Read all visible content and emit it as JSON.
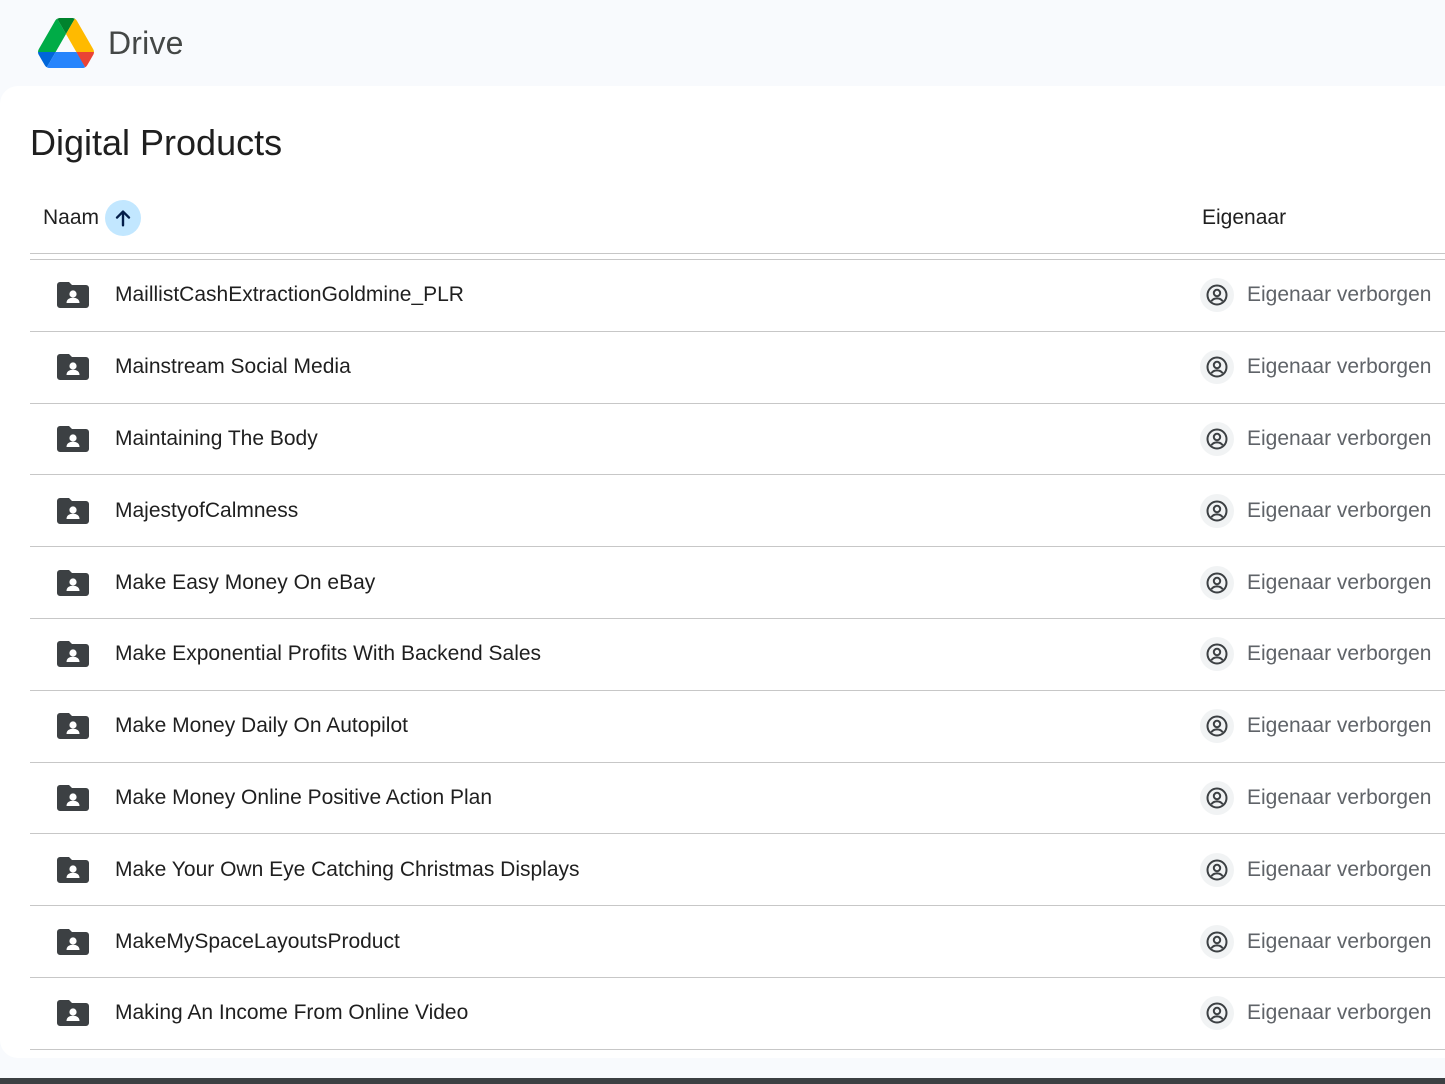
{
  "app": {
    "name": "Drive"
  },
  "folder": {
    "title": "Digital Products"
  },
  "columns": {
    "name": "Naam",
    "owner": "Eigenaar",
    "sort": "ascending"
  },
  "rows": [
    {
      "name": "MaillistCashExtractionGoldmine_PLR",
      "owner": "Eigenaar verborgen"
    },
    {
      "name": "Mainstream Social Media",
      "owner": "Eigenaar verborgen"
    },
    {
      "name": "Maintaining The Body",
      "owner": "Eigenaar verborgen"
    },
    {
      "name": "MajestyofCalmness",
      "owner": "Eigenaar verborgen"
    },
    {
      "name": "Make Easy Money On eBay",
      "owner": "Eigenaar verborgen"
    },
    {
      "name": "Make Exponential Profits With Backend Sales",
      "owner": "Eigenaar verborgen"
    },
    {
      "name": "Make Money Daily On Autopilot",
      "owner": "Eigenaar verborgen"
    },
    {
      "name": "Make Money Online Positive Action Plan",
      "owner": "Eigenaar verborgen"
    },
    {
      "name": "Make Your Own Eye Catching Christmas Displays",
      "owner": "Eigenaar verborgen"
    },
    {
      "name": "MakeMySpaceLayoutsProduct",
      "owner": "Eigenaar verborgen"
    },
    {
      "name": "Making An Income From Online Video",
      "owner": "Eigenaar verborgen"
    }
  ],
  "icons": {
    "logo": "google-drive-logo",
    "folder": "shared-folder-icon",
    "owner": "account-circle-icon",
    "sort": "arrow-up-icon"
  },
  "colors": {
    "background": "#f8fafd",
    "panel": "#ffffff",
    "sort_highlight": "#c2e7ff",
    "text": "#1f1f1f",
    "muted": "#5f6368"
  }
}
